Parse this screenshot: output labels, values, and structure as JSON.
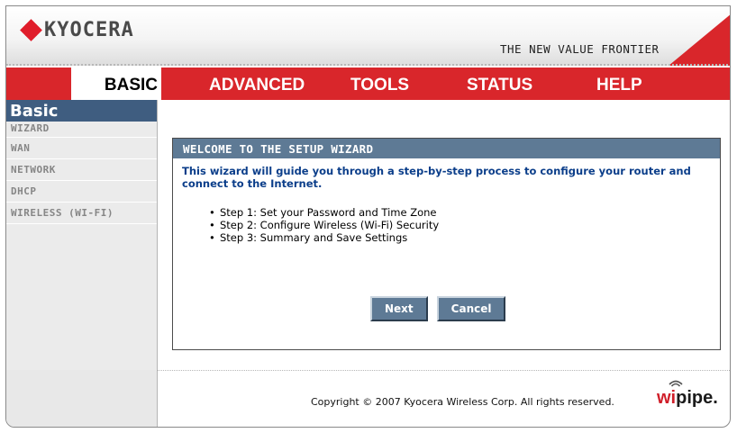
{
  "header": {
    "brand": "KYOCERA",
    "tagline": "THE NEW VALUE FRONTIER"
  },
  "nav": {
    "tabs": [
      {
        "label": "BASIC",
        "active": true
      },
      {
        "label": "ADVANCED",
        "active": false
      },
      {
        "label": "TOOLS",
        "active": false
      },
      {
        "label": "STATUS",
        "active": false
      },
      {
        "label": "HELP",
        "active": false
      }
    ]
  },
  "sidebar": {
    "title": "Basic",
    "items": [
      {
        "label": "WIZARD"
      },
      {
        "label": "WAN"
      },
      {
        "label": "NETWORK"
      },
      {
        "label": "DHCP"
      },
      {
        "label": "WIRELESS (WI-FI)"
      }
    ]
  },
  "wizard": {
    "title": "WELCOME TO THE SETUP WIZARD",
    "description": "This wizard will guide you through a step-by-step process to configure your router and connect to the Internet.",
    "steps": [
      "Step 1: Set your Password and Time Zone",
      "Step 2: Configure Wireless (Wi-Fi) Security",
      "Step 3: Summary and Save Settings"
    ],
    "next_label": "Next",
    "cancel_label": "Cancel"
  },
  "footer": {
    "copyright": "Copyright © 2007 Kyocera Wireless Corp. All rights reserved.",
    "logo_prefix": "wi",
    "logo_suffix": "pipe."
  },
  "colors": {
    "nav_red": "#d9262b",
    "panel_header": "#5e7a95",
    "sidebar_title": "#3f5d80",
    "desc_text": "#0b3e8a"
  }
}
